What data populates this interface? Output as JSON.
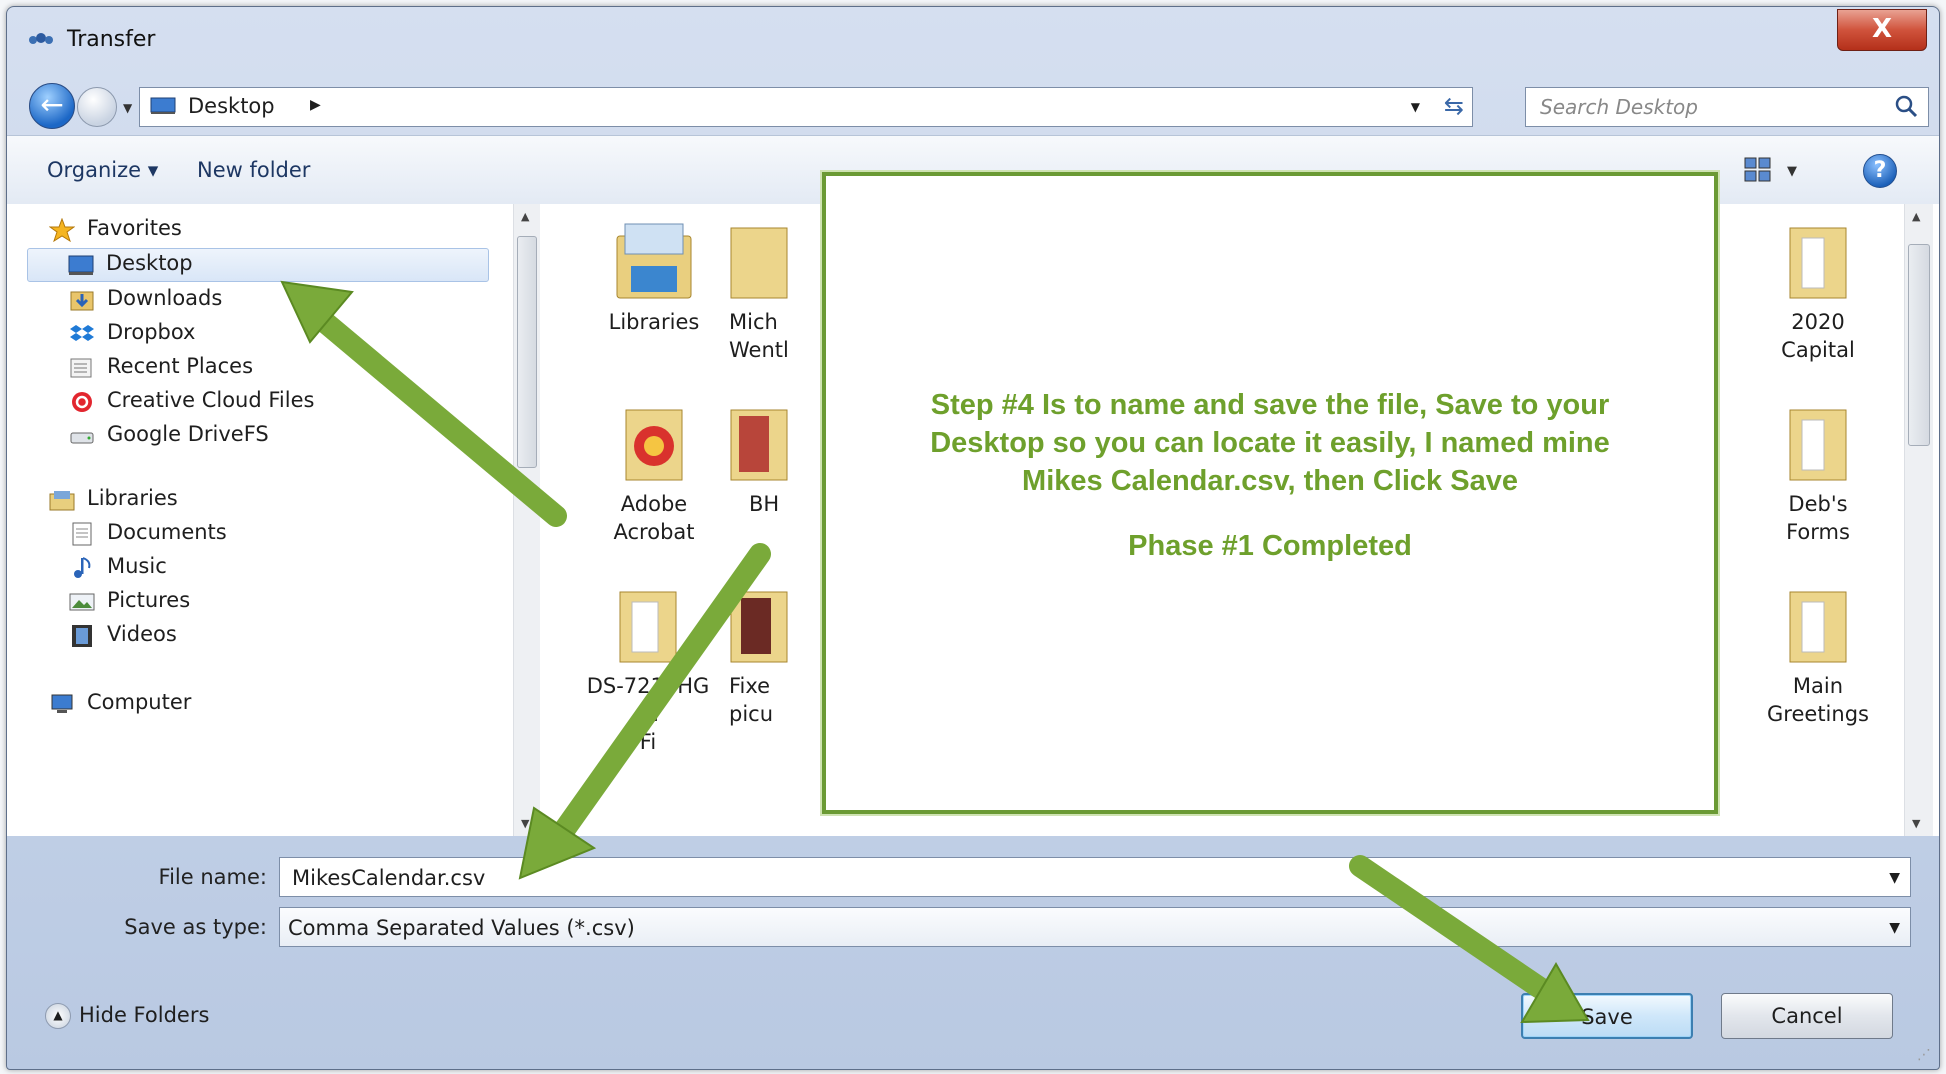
{
  "window": {
    "title": "Transfer",
    "close_label": "X"
  },
  "nav": {
    "address": "Desktop",
    "search_placeholder": "Search Desktop"
  },
  "toolbar": {
    "organize": "Organize ▾",
    "new_folder": "New folder",
    "help": "?"
  },
  "sidebar": {
    "favorites": "Favorites",
    "desktop": "Desktop",
    "downloads": "Downloads",
    "dropbox": "Dropbox",
    "recent": "Recent Places",
    "creative": "Creative Cloud Files",
    "gdrive": "Google DriveFS",
    "libraries": "Libraries",
    "documents": "Documents",
    "music": "Music",
    "pictures": "Pictures",
    "videos": "Videos",
    "computer": "Computer"
  },
  "files": {
    "libraries": "Libraries",
    "mich_line1": "Mich",
    "mich_line2": "Wentl",
    "capital_line1": "2020",
    "capital_line2": "Capital",
    "adobe_line1": "Adobe",
    "adobe_line2": "Acrobat",
    "bh": "BH",
    "debs_line1": "Deb's",
    "debs_line2": "Forms",
    "ds_line1": "DS-7216HG",
    "ds_line2": "HI",
    "ds_line3": "Fi",
    "fixe_line1": "Fixe",
    "fixe_line2": "picu",
    "main_line1": "Main",
    "main_line2": "Greetings"
  },
  "callout": {
    "line1": "Step #4 Is to name and save the file, Save to your",
    "line2": "Desktop so you can locate it easily, I named mine",
    "line3": "Mikes Calendar.csv, then Click Save",
    "phase": "Phase #1 Completed"
  },
  "form": {
    "filename_label": "File name:",
    "filename_value": "MikesCalendar.csv",
    "savetype_label": "Save as type:",
    "savetype_value": "Comma Separated Values (*.csv)"
  },
  "footer": {
    "hide_folders": "Hide Folders",
    "save": "Save",
    "cancel": "Cancel"
  },
  "colors": {
    "arrow": "#7aaa3a",
    "callout_border": "#6b9a34",
    "callout_text": "#6ea02c"
  }
}
